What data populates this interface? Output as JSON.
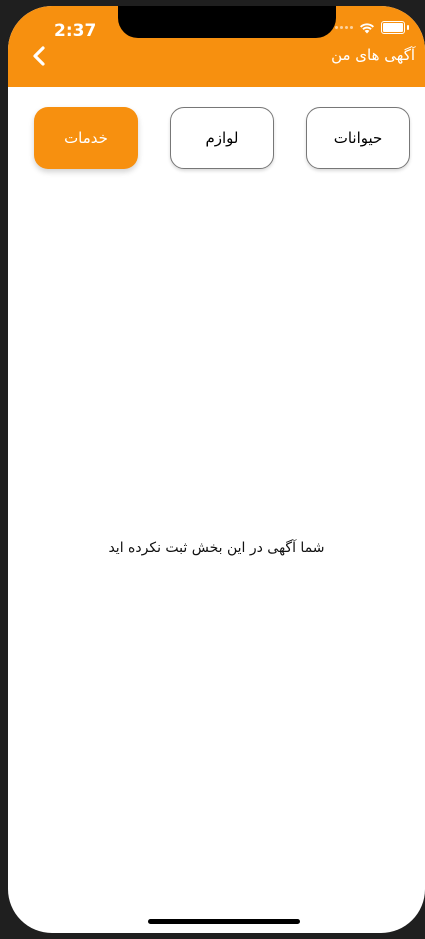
{
  "status_bar": {
    "time": "2:37"
  },
  "header": {
    "title": "آگهی های من",
    "back_icon": "chevron-left-icon"
  },
  "categories": [
    {
      "label": "حیوانات",
      "selected": false
    },
    {
      "label": "لوازم",
      "selected": false
    },
    {
      "label": "خدمات",
      "selected": true
    }
  ],
  "empty_message": "شما آگهی در این بخش ثبت نکرده اید",
  "colors": {
    "accent": "#f7900f",
    "background": "#ffffff"
  }
}
